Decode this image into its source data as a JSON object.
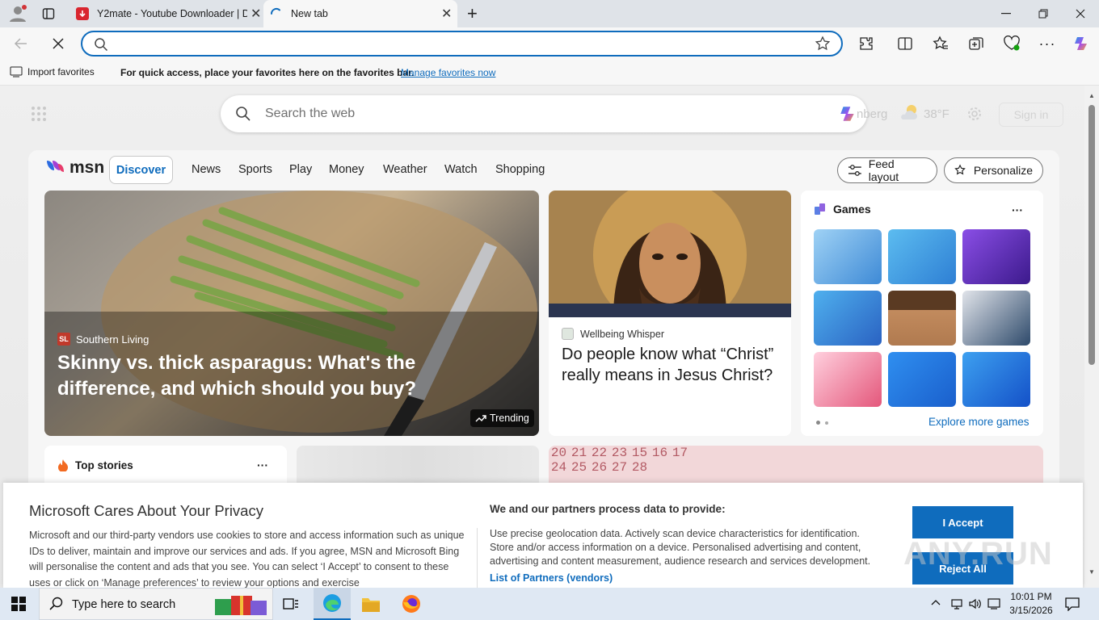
{
  "browser": {
    "tabs": [
      {
        "title": "Y2mate - Youtube Downloader | D",
        "icon": "y2mate-icon"
      },
      {
        "title": "New tab",
        "icon": "loading-spinner-icon"
      }
    ],
    "address": {
      "value": "",
      "placeholder": ""
    },
    "favorites_bar": {
      "import_label": "Import favorites",
      "hint": "For quick access, place your favorites here on the favorites bar.",
      "manage_link": "Manage favorites now"
    }
  },
  "newtab": {
    "search_placeholder": "Search the web",
    "location": "nberg",
    "temperature": "38°F",
    "signin": "Sign in"
  },
  "msn": {
    "logo": "msn",
    "nav": [
      "Discover",
      "News",
      "Sports",
      "Play",
      "Money",
      "Weather",
      "Watch",
      "Shopping"
    ],
    "active_nav": "Discover",
    "feed_layout": "Feed layout",
    "personalize": "Personalize"
  },
  "hero": {
    "source": "Southern Living",
    "source_badge": "SL",
    "title": "Skinny vs. thick asparagus: What's the difference, and which should you buy?",
    "badge": "Trending"
  },
  "story2": {
    "source": "Wellbeing Whisper",
    "title": "Do people know what “Christ” really means in Jesus Christ?"
  },
  "games": {
    "title": "Games",
    "more_label": "···",
    "explore": "Explore more games",
    "tile_colors": [
      "#6fb3e8",
      "#4aa8e0",
      "#6c35c8",
      "#3a8fd6",
      "#8b5a2b",
      "#2e4a6b",
      "#f2a7c0",
      "#1f7fe0",
      "#1c6fd8"
    ]
  },
  "top_stories": {
    "title": "Top stories",
    "more_label": "···"
  },
  "calendar_numbers": [
    "20",
    "21",
    "22",
    "23",
    "24",
    "25",
    "26",
    "27",
    "28",
    "15",
    "16",
    "17"
  ],
  "privacy": {
    "title": "Microsoft Cares About Your Privacy",
    "body": "Microsoft and our third-party vendors use cookies to store and access information such as unique IDs to deliver, maintain and improve our services and ads. If you agree, MSN and Microsoft Bing will personalise the content and ads that you see. You can select ‘I Accept’ to consent to these uses or click on ‘Manage preferences’ to review your options and exercise",
    "right_title": "We and our partners process data to provide:",
    "right_body": "Use precise geolocation data. Actively scan device characteristics for identification. Store and/or access information on a device. Personalised advertising and content, advertising and content measurement, audience research and services development.",
    "partners_link": "List of Partners (vendors)",
    "accept": "I Accept",
    "reject": "Reject All"
  },
  "watermark": "ANY.RUN",
  "taskbar": {
    "search_placeholder": "Type here to search",
    "time": "10:01 PM",
    "date": "3/15/2026"
  },
  "colors": {
    "accent": "#0f6cbd",
    "privacy_button": "#0f6cbd"
  }
}
